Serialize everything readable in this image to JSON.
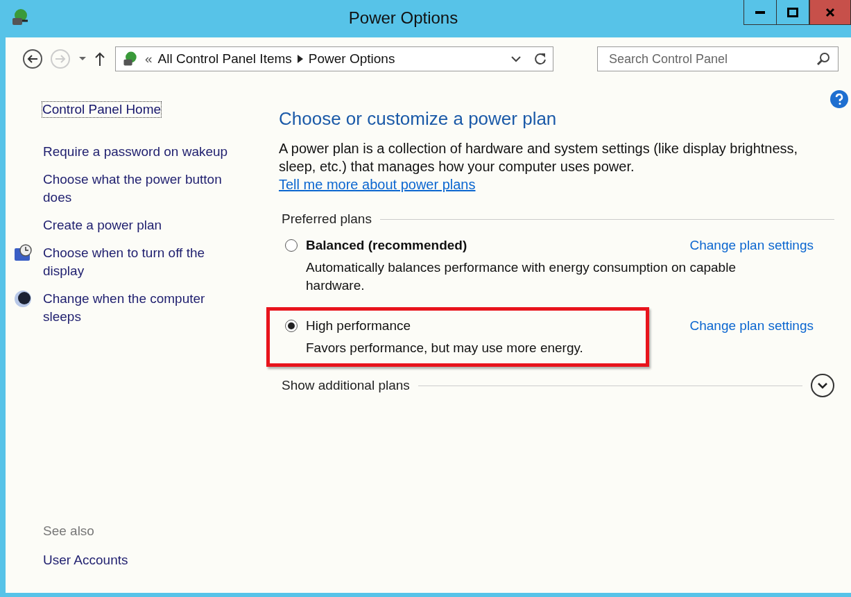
{
  "window": {
    "title": "Power Options"
  },
  "toolbar": {
    "breadcrumb": [
      "All Control Panel Items",
      "Power Options"
    ],
    "overflow": "«",
    "search": {
      "placeholder": "Search Control Panel"
    }
  },
  "sidebar": {
    "home": "Control Panel Home",
    "items": [
      {
        "kind": "plain",
        "label": "Require a password on wakeup"
      },
      {
        "kind": "plain",
        "label": "Choose what the power button does"
      },
      {
        "kind": "plain",
        "label": "Create a power plan"
      },
      {
        "kind": "display",
        "label": "Choose when to turn off the display"
      },
      {
        "kind": "sleep",
        "label": "Change when the computer sleeps"
      }
    ],
    "see_also": {
      "heading": "See also",
      "items": [
        "User Accounts"
      ]
    }
  },
  "main": {
    "heading": "Choose or customize a power plan",
    "intro": "A power plan is a collection of hardware and system settings (like display brightness, sleep, etc.) that manages how your computer uses power.",
    "intro_link": "Tell me more about power plans",
    "group": "Preferred plans",
    "plans": [
      {
        "name": "Balanced (recommended)",
        "bold": true,
        "selected": false,
        "highlighted": false,
        "description": "Automatically balances performance with energy consumption on capable hardware.",
        "link": "Change plan settings"
      },
      {
        "name": "High performance",
        "bold": false,
        "selected": true,
        "highlighted": true,
        "description": "Favors performance, but may use more energy.",
        "link": "Change plan settings"
      }
    ],
    "more": "Show additional plans"
  }
}
